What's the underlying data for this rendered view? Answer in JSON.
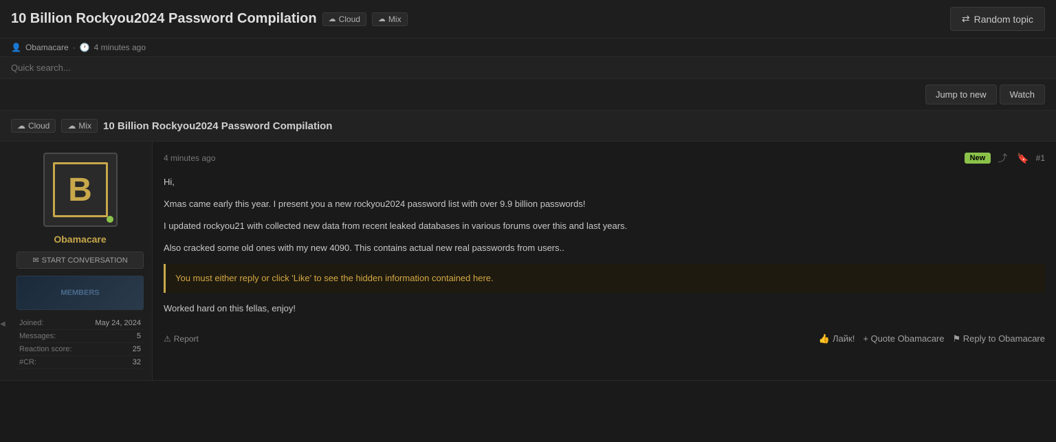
{
  "header": {
    "title": "10 Billion Rockyou2024 Password Compilation",
    "tags": [
      {
        "id": "cloud",
        "icon": "☁",
        "label": "Cloud"
      },
      {
        "id": "mix",
        "icon": "☁",
        "label": "Mix"
      }
    ],
    "random_topic_btn": "Random topic",
    "random_icon": "⇄"
  },
  "author_row": {
    "icon": "👤",
    "username": "Obamacare",
    "separator": "·",
    "time_icon": "🕐",
    "time": "4 minutes ago"
  },
  "search": {
    "placeholder": "Quick search..."
  },
  "action_bar": {
    "jump_label": "Jump to new",
    "watch_label": "Watch"
  },
  "thread_tags_row": {
    "tags": [
      {
        "icon": "☁",
        "label": "Cloud"
      },
      {
        "icon": "☁",
        "label": "Mix"
      }
    ],
    "thread_title": "10 Billion Rockyou2024 Password Compilation"
  },
  "post": {
    "time": "4 minutes ago",
    "new_badge": "New",
    "post_num": "#1",
    "body": {
      "greeting": "Hi,",
      "line1": "Xmas came early this year. I present you a new rockyou2024 password list with over 9.9 billion passwords!",
      "line2": "I updated rockyou21 with collected new data from recent leaked databases in various forums over this and last years.",
      "line3": "Also cracked some old ones with my new 4090. This contains actual new real passwords from users..",
      "hidden_notice": "You must either reply or click 'Like' to see the hidden information contained here.",
      "closing": "Worked hard on this fellas, enjoy!"
    },
    "footer": {
      "report_label": "Report",
      "like_label": "Лайк!",
      "quote_label": "+ Quote Obamacare",
      "reply_label": "⚑ Reply to Obamacare"
    }
  },
  "user": {
    "username": "Obamacare",
    "avatar_letter": "B",
    "start_convo_label": "START CONVERSATION",
    "banner_text": "MEMBERS",
    "stats": [
      {
        "label": "Joined:",
        "value": "May 24, 2024"
      },
      {
        "label": "Messages:",
        "value": "5"
      },
      {
        "label": "Reaction score:",
        "value": "25"
      },
      {
        "label": "#CR:",
        "value": "32"
      }
    ]
  }
}
